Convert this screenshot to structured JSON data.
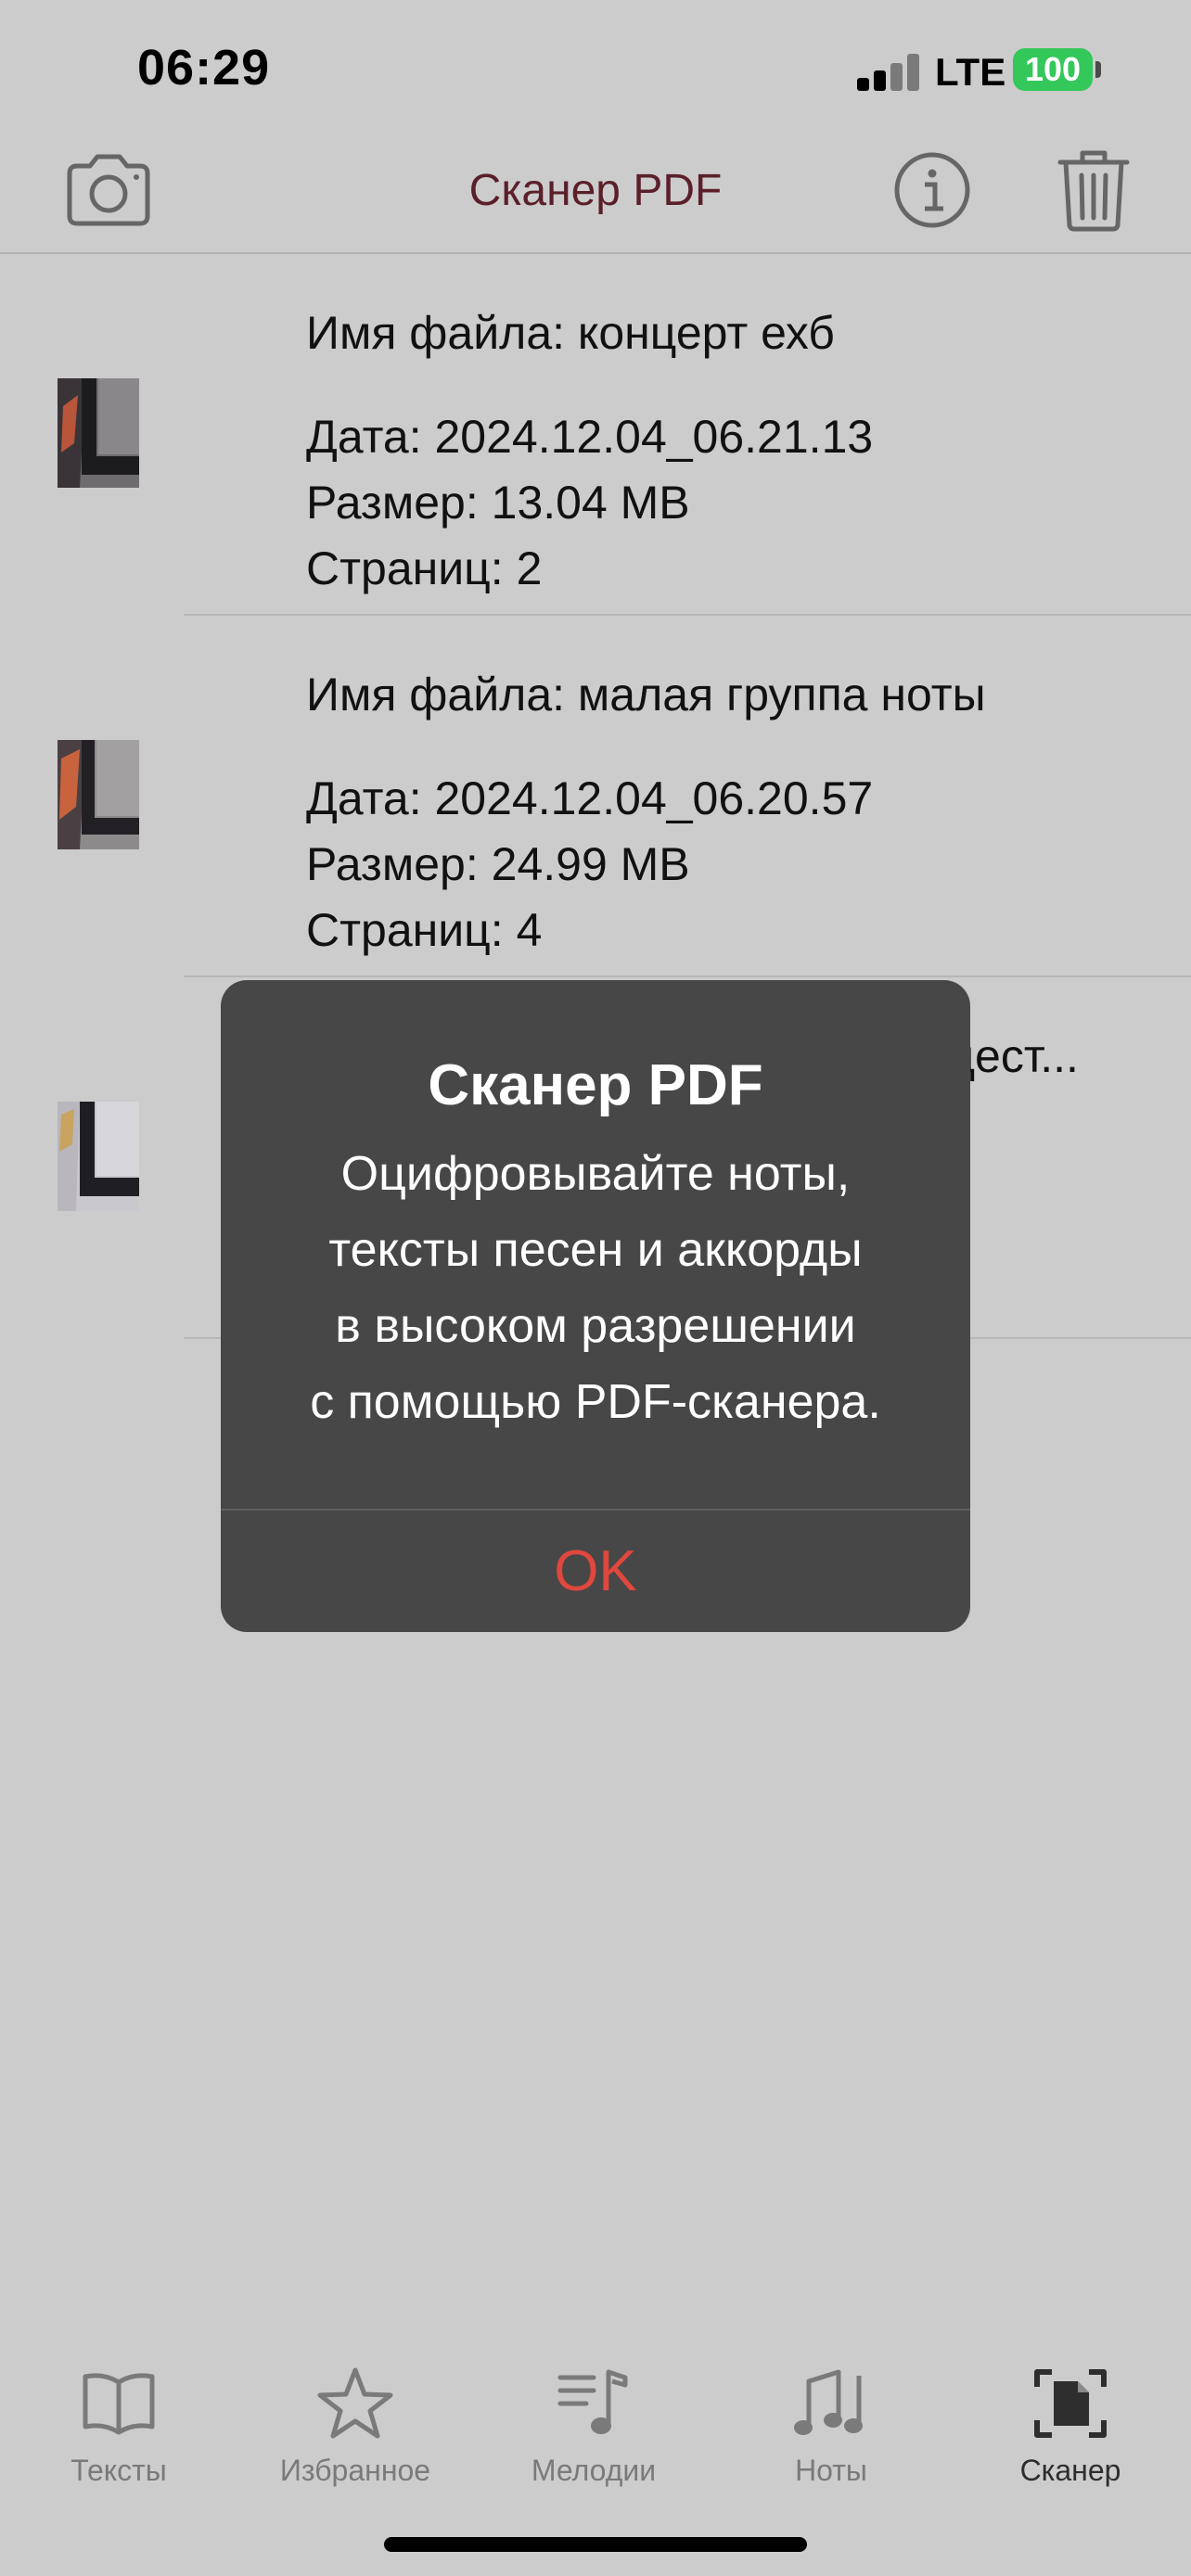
{
  "status_bar": {
    "time": "06:29",
    "network": "LTE",
    "battery": "100",
    "battery_color": "#34c759"
  },
  "nav": {
    "title": "Сканер PDF",
    "title_color": "#5b1f2a",
    "icons": [
      "camera-icon",
      "info-icon",
      "trash-icon"
    ]
  },
  "files": [
    {
      "name": "Имя файла: концерт ехб",
      "date": "Дата: 2024.12.04_06.21.13",
      "size": "Размер: 13.04 MB",
      "pages": "Страниц: 2"
    },
    {
      "name": "Имя файла: малая группа ноты",
      "date": "Дата: 2024.12.04_06.20.57",
      "size": "Размер: 24.99 MB",
      "pages": "Страниц: 4"
    },
    {
      "name_fragment": "кдест..."
    }
  ],
  "alert": {
    "title": "Сканер PDF",
    "message_lines": [
      "Оцифровывайте ноты,",
      "тексты песен и аккорды",
      "в высоком разрешении",
      "с помощью PDF-сканера."
    ],
    "button": "OK",
    "button_color": "#e0473d"
  },
  "tabs": [
    {
      "label": "Тексты",
      "icon": "book-icon"
    },
    {
      "label": "Избранное",
      "icon": "star-icon"
    },
    {
      "label": "Мелодии",
      "icon": "music-list-icon"
    },
    {
      "label": "Ноты",
      "icon": "music-notes-icon"
    },
    {
      "label": "Сканер",
      "icon": "scanner-icon",
      "active": true
    }
  ]
}
